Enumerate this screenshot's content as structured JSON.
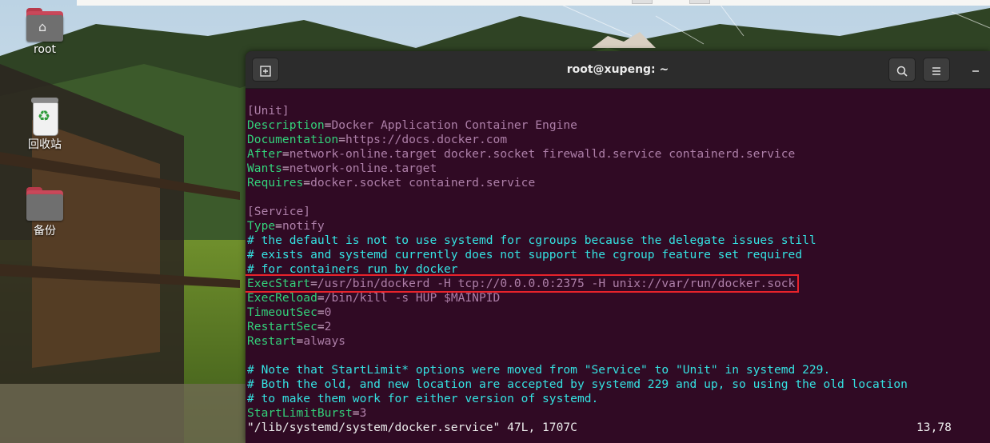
{
  "desktop": {
    "icons": [
      {
        "label": "root",
        "icon": "home-folder-icon"
      },
      {
        "label": "回收站",
        "icon": "trash-icon"
      },
      {
        "label": "备份",
        "icon": "folder-icon"
      }
    ]
  },
  "window": {
    "title": "root@xupeng: ~",
    "new_tab_icon": "new-tab-icon",
    "search_icon": "search-icon",
    "menu_icon": "hamburger-menu-icon",
    "minimize_icon": "minimize-icon"
  },
  "colors": {
    "terminal_bg": "#300a24",
    "key": "#33d17a",
    "value": "#ad7fa8",
    "comment": "#34e2e2",
    "highlight_box": "#e8232b"
  },
  "file": {
    "l1": "[Unit]",
    "l2k": "Description",
    "l2v": "Docker Application Container Engine",
    "l3k": "Documentation",
    "l3v": "https://docs.docker.com",
    "l4k": "After",
    "l4v": "network-online.target docker.socket firewalld.service containerd.service",
    "l5k": "Wants",
    "l5v": "network-online.target",
    "l6k": "Requires",
    "l6v": "docker.socket containerd.service",
    "l8": "[Service]",
    "l9k": "Type",
    "l9v": "notify",
    "l10": "# the default is not to use systemd for cgroups because the delegate issues still",
    "l11": "# exists and systemd currently does not support the cgroup feature set required",
    "l12": "# for containers run by docker",
    "l13k": "ExecStart",
    "l13v": "/usr/bin/dockerd -H tcp://0.0.0.0:2375 -H unix://var/run/docker.sock",
    "l14k": "ExecReload",
    "l14v": "/bin/kill -s HUP $MAINPID",
    "l15k": "TimeoutSec",
    "l15v": "0",
    "l16k": "RestartSec",
    "l16v": "2",
    "l17k": "Restart",
    "l17v": "always",
    "l19": "# Note that StartLimit* options were moved from \"Service\" to \"Unit\" in systemd 229.",
    "l20": "# Both the old, and new location are accepted by systemd 229 and up, so using the old location",
    "l21": "# to make them work for either version of systemd.",
    "l22k": "StartLimitBurst",
    "l22v": "3"
  },
  "status": {
    "file": "\"/lib/systemd/system/docker.service\" 47L, 1707C",
    "position": "13,78"
  }
}
